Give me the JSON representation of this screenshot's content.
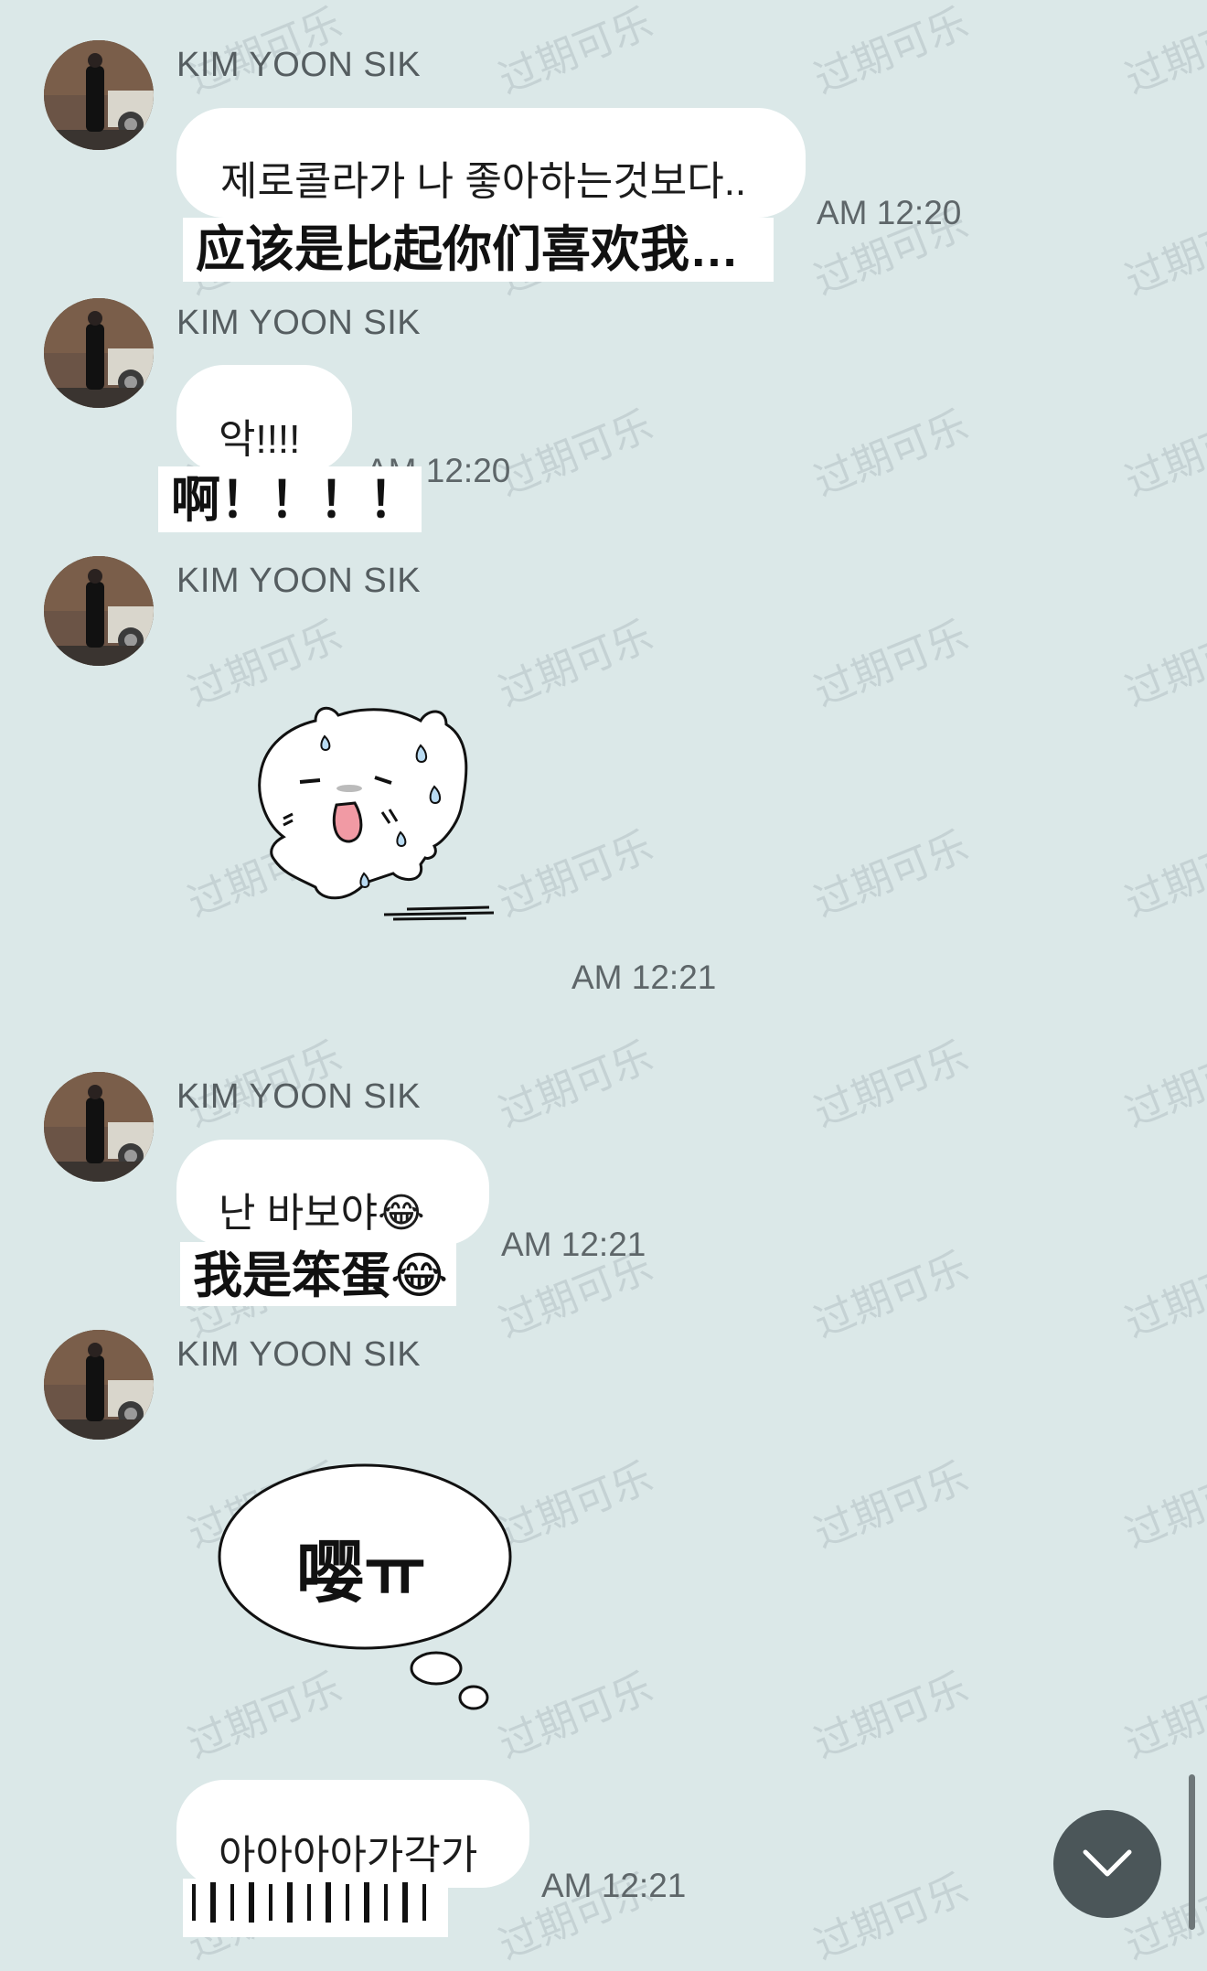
{
  "watermark_text": "过期可乐",
  "messages": [
    {
      "sender": "KIM YOON SIK",
      "text": "제로콜라가 나 좋아하는것보다..",
      "translation": "应该是比起你们喜欢我…",
      "time": "AM 12:20"
    },
    {
      "sender": "KIM YOON SIK",
      "text": "악!!!!",
      "translation": "啊！！！！",
      "time": "AM 12:20"
    },
    {
      "sender": "KIM YOON SIK",
      "sticker": "sweating-bear-sticker",
      "time": "AM 12:21"
    },
    {
      "sender": "KIM YOON SIK",
      "text": "난 바보야😂",
      "translation": "我是笨蛋😂",
      "time": "AM 12:21"
    },
    {
      "sender": "KIM YOON SIK",
      "sticker_text": "嘤ㅠ",
      "sticker": "speech-cloud-sticker"
    },
    {
      "text": "아아아아가각가",
      "time": "AM 12:21"
    }
  ],
  "controls": {
    "scroll_button_icon": "chevron-down-icon"
  },
  "colors": {
    "background": "#dbe8e8",
    "bubble": "#ffffff",
    "scroll_button": "#4b5659"
  }
}
